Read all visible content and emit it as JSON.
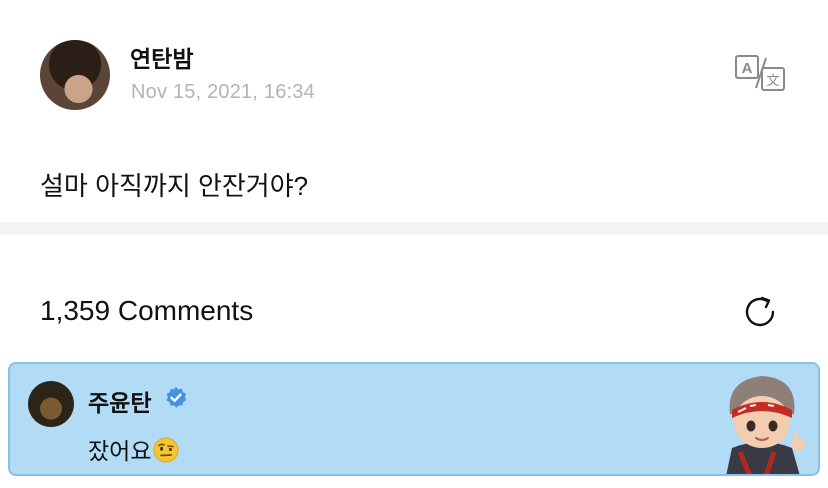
{
  "post": {
    "author": "연탄밤",
    "date": "Nov 15, 2021, 16:34",
    "text": "설마 아직까지 안잔거야?",
    "translate_icon": "translate-icon"
  },
  "comments": {
    "count_label": "1,359 Comments",
    "refresh_icon": "refresh-icon",
    "items": [
      {
        "author": "주윤탄",
        "verified": true,
        "text": "잤어요",
        "emoji": "raised-eyebrow-emoji",
        "highlighted": true
      }
    ]
  },
  "colors": {
    "highlight_bg": "#b2dbf5",
    "highlight_border": "#87c1e8",
    "verified_blue": "#4a90e2",
    "date_gray": "#b3b3b3"
  }
}
